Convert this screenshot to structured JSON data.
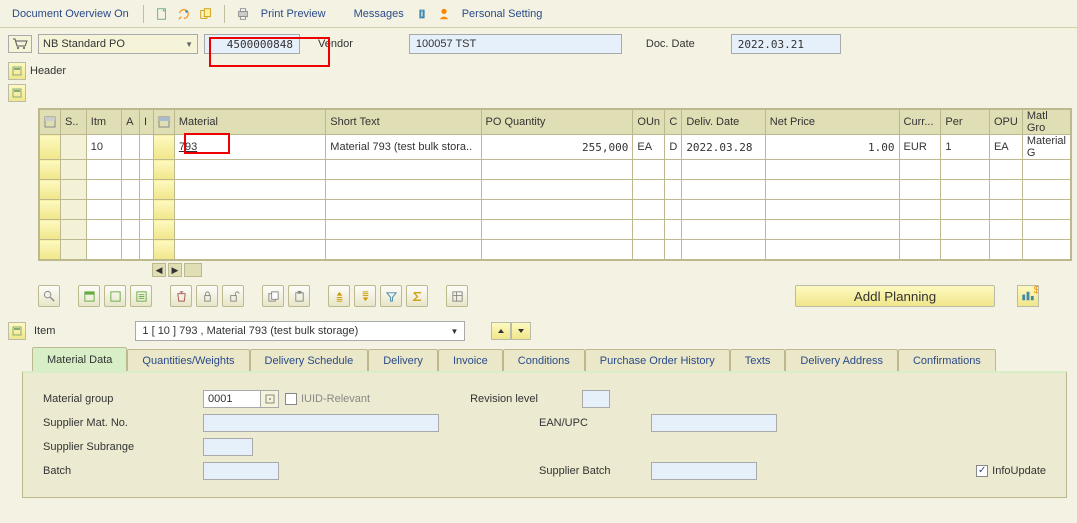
{
  "toolbar": {
    "doc_overview": "Document Overview On",
    "print_preview": "Print Preview",
    "messages": "Messages",
    "personal_setting": "Personal Setting"
  },
  "po": {
    "type": "NB Standard PO",
    "number": "4500000848",
    "vendor_label": "Vendor",
    "vendor": "100057 TST",
    "doc_date_label": "Doc. Date",
    "doc_date": "2022.03.21"
  },
  "header_label": "Header",
  "grid": {
    "headers": {
      "s": "S..",
      "itm": "Itm",
      "a": "A",
      "i": "I",
      "material": "Material",
      "short_text": "Short Text",
      "po_qty": "PO Quantity",
      "oun": "OUn",
      "c": "C",
      "deliv_date": "Deliv. Date",
      "net_price": "Net Price",
      "curr": "Curr...",
      "per": "Per",
      "opu": "OPU",
      "matl_gro": "Matl Gro"
    },
    "rows": [
      {
        "itm": "10",
        "material": "793",
        "short_text": "Material 793 (test bulk stora..",
        "po_qty": "255,000",
        "oun": "EA",
        "c": "D",
        "deliv_date": "2022.03.28",
        "net_price": "1.00",
        "curr": "EUR",
        "per": "1",
        "opu": "EA",
        "matl_gro": "Material G"
      }
    ]
  },
  "addl_planning": "Addl Planning",
  "item_detail": {
    "label": "Item",
    "selected": "1 [ 10 ] 793 , Material 793 (test bulk storage)"
  },
  "tabs": {
    "material_data": "Material Data",
    "quantities_weights": "Quantities/Weights",
    "delivery_schedule": "Delivery Schedule",
    "delivery": "Delivery",
    "invoice": "Invoice",
    "conditions": "Conditions",
    "po_history": "Purchase Order History",
    "texts": "Texts",
    "delivery_address": "Delivery Address",
    "confirmations": "Confirmations"
  },
  "material_data": {
    "material_group_label": "Material group",
    "material_group": "0001",
    "iuid_relevant": "IUID-Relevant",
    "revision_level_label": "Revision level",
    "supplier_mat_no_label": "Supplier Mat. No.",
    "ean_upc_label": "EAN/UPC",
    "supplier_subrange_label": "Supplier Subrange",
    "batch_label": "Batch",
    "supplier_batch_label": "Supplier Batch",
    "info_update_label": "InfoUpdate"
  }
}
